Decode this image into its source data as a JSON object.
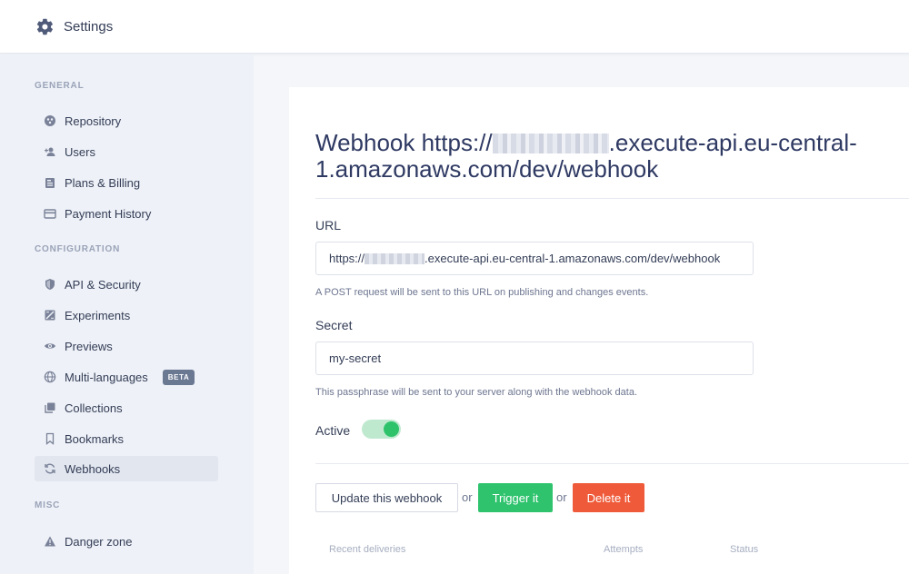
{
  "header": {
    "title": "Settings",
    "icon": "gear-icon"
  },
  "sidebar": {
    "sections": [
      {
        "label": "GENERAL"
      },
      {
        "label": "CONFIGURATION"
      },
      {
        "label": "MISC"
      }
    ],
    "items": [
      {
        "label": "Repository",
        "icon": "repository-icon"
      },
      {
        "label": "Users",
        "icon": "users-icon"
      },
      {
        "label": "Plans & Billing",
        "icon": "billing-icon"
      },
      {
        "label": "Payment History",
        "icon": "credit-card-icon"
      },
      {
        "label": "API & Security",
        "icon": "shield-icon"
      },
      {
        "label": "Experiments",
        "icon": "experiments-icon"
      },
      {
        "label": "Previews",
        "icon": "eye-icon"
      },
      {
        "label": "Multi-languages",
        "icon": "globe-icon",
        "badge": "BETA"
      },
      {
        "label": "Collections",
        "icon": "collections-icon"
      },
      {
        "label": "Bookmarks",
        "icon": "bookmark-icon"
      },
      {
        "label": "Webhooks",
        "icon": "refresh-icon",
        "active": true
      },
      {
        "label": "Danger zone",
        "icon": "warning-icon"
      }
    ]
  },
  "main": {
    "heading_prefix": "Webhook https://",
    "heading_suffix": ".execute-api.eu-central-1.amazonaws.com/dev/webhook",
    "url_label": "URL",
    "url_prefix": "https://",
    "url_suffix": ".execute-api.eu-central-1.amazonaws.com/dev/webhook",
    "url_hint": "A POST request will be sent to this URL on publishing and changes events.",
    "secret_label": "Secret",
    "secret_value": "my-secret",
    "secret_hint": "This passphrase will be sent to your server along with the webhook data.",
    "active_label": "Active",
    "active": true,
    "buttons": {
      "update": "Update this webhook",
      "or1": "or",
      "trigger": "Trigger it",
      "or2": "or",
      "delete": "Delete it"
    },
    "table": {
      "headers": [
        "Recent deliveries",
        "Attempts",
        "Status"
      ]
    }
  },
  "colors": {
    "accent_green": "#2fc36e",
    "danger_red": "#ef5b3a",
    "heading": "#2f3a63"
  }
}
